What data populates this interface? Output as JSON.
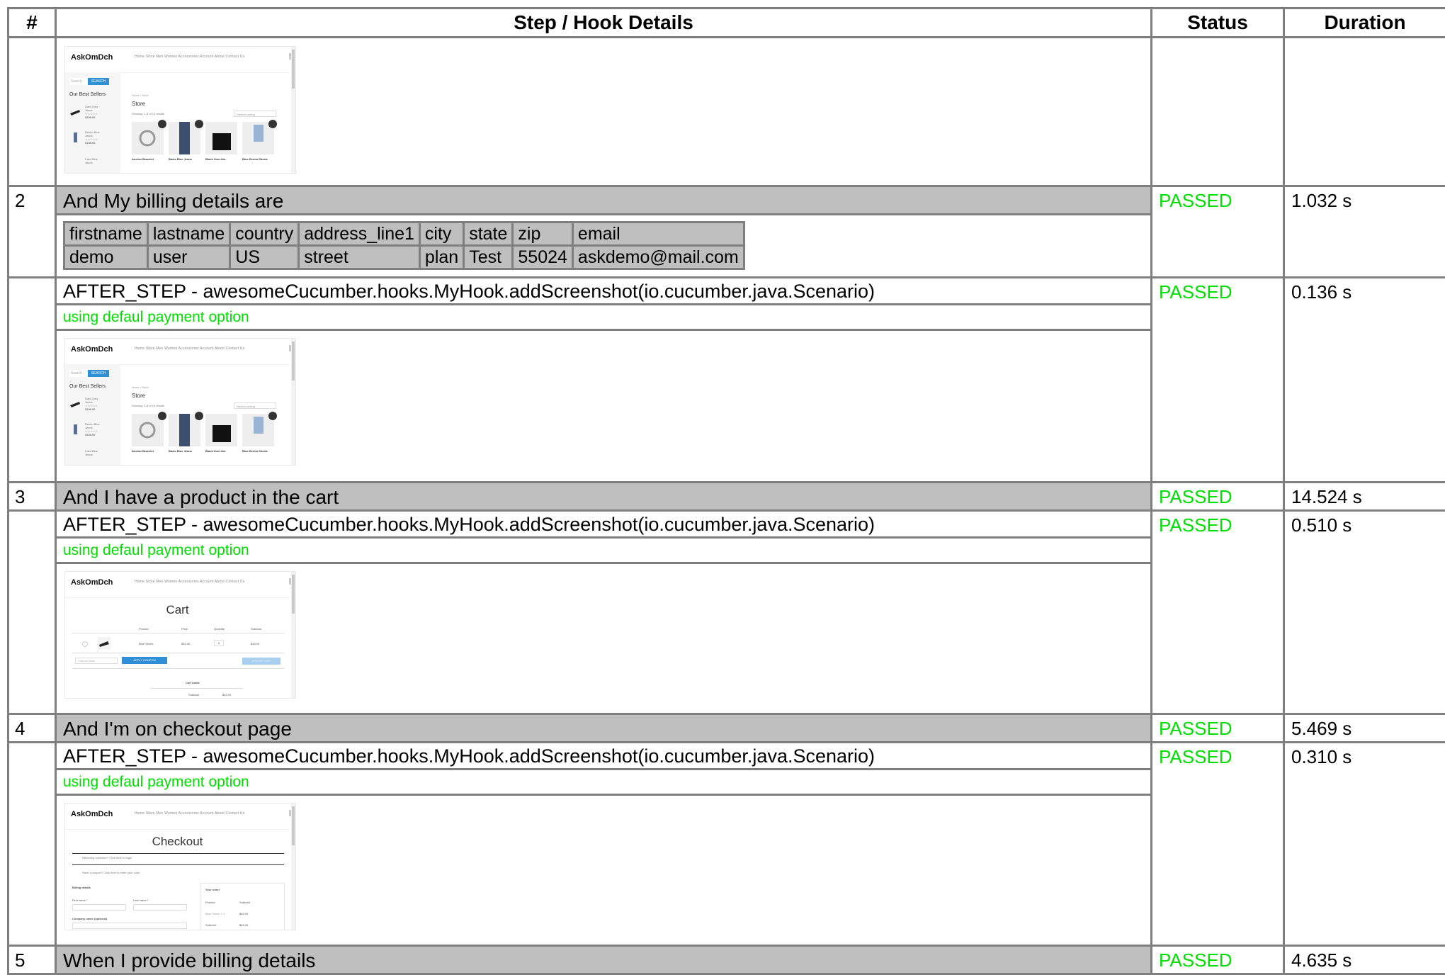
{
  "headers": {
    "num": "#",
    "step": "Step / Hook Details",
    "status": "Status",
    "duration": "Duration"
  },
  "hook_label": "AFTER_STEP - awesomeCucumber.hooks.MyHook.addScreenshot(io.cucumber.java.Scenario)",
  "hook_message": "using defaul payment option",
  "store_shot": {
    "brand": "AskOmDch",
    "nav": "Home    Store    Men    Women    Accessories    Account    About    Contact Us",
    "search_placeholder": "Search",
    "search_button": "SEARCH",
    "sidebar_title": "Our Best Sellers",
    "sidebar_items": [
      [
        "Dark Grey",
        "Jeans",
        "☆☆☆☆☆",
        "$108.00"
      ],
      [
        "Denim Blue",
        "Jeans",
        "☆☆☆☆☆",
        "$108.00"
      ],
      [
        "Faint Blue",
        "Jeans",
        "",
        ""
      ]
    ],
    "breadcrumb": "Home / Store",
    "page_title": "Store",
    "result_count": "Showing 1–8 of 13 results",
    "sort": "Default sorting",
    "products": [
      "Anchor Bracelet",
      "Basic Blue Jeans",
      "Black Over-the-",
      "Blue Denim Shorts"
    ]
  },
  "cart_shot": {
    "brand": "AskOmDch",
    "nav": "Home    Store    Men    Women    Accessories    Account    About    Contact Us",
    "title": "Cart",
    "col_product": "Product",
    "col_price": "Price",
    "col_qty": "Quantity",
    "col_subtotal": "Subtotal",
    "item_name": "Blue Shoes",
    "item_price": "$45.00",
    "item_qty": "1",
    "item_subtotal": "$45.00",
    "coupon_placeholder": "Coupon code",
    "apply_coupon": "APPLY COUPON",
    "update_cart": "UPDATE CART",
    "totals_title": "Cart totals",
    "totals_subtotal_label": "Subtotal",
    "totals_subtotal_value": "$45.00"
  },
  "checkout_shot": {
    "brand": "AskOmDch",
    "nav": "Home    Store    Men    Women    Accessories    Account    About    Contact Us",
    "title": "Checkout",
    "returning": "Returning customer? Click here to login",
    "coupon": "Have a coupon? Click here to enter your code",
    "billing_title": "Billing details",
    "first_name": "First name *",
    "last_name": "Last name *",
    "company": "Company name (optional)",
    "order_title": "Your order",
    "order_product": "Product",
    "order_subtotal": "Subtotal",
    "order_item": "Blue Shoes × 1",
    "order_item_price": "$45.00",
    "order_sub_label": "Subtotal",
    "order_sub_value": "$45.00"
  },
  "rows": [
    {
      "num": "2",
      "step": "And My billing details are",
      "status": "PASSED",
      "duration": "1.032 s"
    },
    {
      "hook_status": "PASSED",
      "hook_duration": "0.136 s"
    },
    {
      "num": "3",
      "step": "And I have a product in the cart",
      "status": "PASSED",
      "duration": "14.524 s"
    },
    {
      "hook_status": "PASSED",
      "hook_duration": "0.510 s"
    },
    {
      "num": "4",
      "step": "And I'm on checkout page",
      "status": "PASSED",
      "duration": "5.469 s"
    },
    {
      "hook_status": "PASSED",
      "hook_duration": "0.310 s"
    },
    {
      "num": "5",
      "step": "When I provide billing details",
      "status": "PASSED",
      "duration": "4.635 s"
    }
  ],
  "billing_table": {
    "columns": [
      "firstname",
      "lastname",
      "country",
      "address_line1",
      "city",
      "state",
      "zip",
      "email"
    ],
    "values": [
      "demo",
      "user",
      "US",
      "street",
      "plan",
      "Test",
      "55024",
      "askdemo@mail.com"
    ]
  }
}
